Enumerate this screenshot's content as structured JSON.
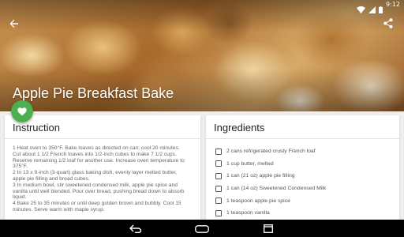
{
  "status_bar": {
    "time": "9:12",
    "icons": [
      "wifi-icon",
      "signal-icon",
      "battery-icon"
    ]
  },
  "header": {
    "back_icon": "arrow-back-icon",
    "share_icon": "share-icon"
  },
  "recipe": {
    "title": "Apple Pie Breakfast Bake",
    "favorite_icon": "heart-icon",
    "favorite_color": "#4caf50"
  },
  "instructions": {
    "title": "Instruction",
    "lines": [
      "1 Heat oven to 350°F. Bake loaves as directed on can; cool 20 minutes.",
      "Cut about 1 1/2 French loaves into 1/2-inch cubes to make 7 1/2 cups.",
      "Reserve remaining 1/2 loaf for another use. Increase oven temperature to",
      "375°F.",
      "2 In 13 x 9-inch (3-quart) glass baking dish, evenly layer melted butter,",
      "apple pie filling and bread cubes.",
      "3 In medium bowl, stir sweetened condensed milk, apple pie spice and",
      "vanilla until well blended. Pour over bread, pushing bread down to absorb",
      "liquid.",
      "4 Bake 25 to 35 minutes or until deep golden brown and bubbly. Cool 15",
      "minutes. Serve warm with maple syrup."
    ]
  },
  "ingredients": {
    "title": "Ingredients",
    "items": [
      "2 cans refrigerated crusty French loaf",
      "1 cup butter, melted",
      "1 can (21 oz) apple pie filling",
      "1 can (14 oz) Sweetened Condensed Milk",
      "1 teaspoon apple pie spice",
      "1 teaspoon vanilla"
    ]
  },
  "nav_bar": {
    "icons": [
      "nav-back-icon",
      "nav-home-icon",
      "nav-recents-icon"
    ]
  }
}
